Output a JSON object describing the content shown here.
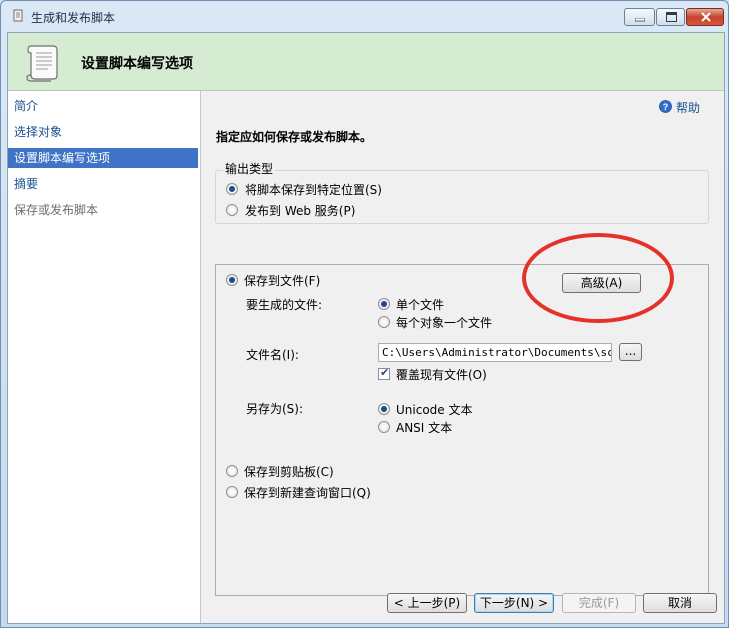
{
  "window": {
    "title": "生成和发布脚本",
    "minimize_icon": "minimize-icon",
    "maximize_icon": "maximize-icon",
    "close_icon": "close-icon"
  },
  "header": {
    "title": "设置脚本编写选项",
    "icon": "script-scroll-icon"
  },
  "nav": {
    "items": [
      {
        "label": "简介"
      },
      {
        "label": "选择对象"
      },
      {
        "label": "设置脚本编写选项"
      },
      {
        "label": "摘要"
      },
      {
        "label": "保存或发布脚本"
      }
    ]
  },
  "help": {
    "label": "帮助",
    "icon": "help-icon"
  },
  "instruction": "指定应如何保存或发布脚本。",
  "output_type": {
    "legend": "输出类型",
    "option_save": "将脚本保存到特定位置(S)",
    "option_publish": "发布到 Web 服务(P)"
  },
  "save_file": {
    "label": "保存到文件(F)",
    "advanced_button": "高级(A)",
    "files_to_generate_label": "要生成的文件:",
    "single_file": "单个文件",
    "file_per_object": "每个对象一个文件",
    "file_name_label": "文件名(I):",
    "file_name_value": "C:\\Users\\Administrator\\Documents\\script.sql",
    "browse_button": "...",
    "overwrite_label": "覆盖现有文件(O)",
    "save_as_label": "另存为(S):",
    "unicode_text": "Unicode 文本",
    "ansi_text": "ANSI 文本"
  },
  "save_clipboard": "保存到剪贴板(C)",
  "save_query_window": "保存到新建查询窗口(Q)",
  "footer": {
    "previous": "< 上一步(P)",
    "next": "下一步(N) >",
    "finish": "完成(F)",
    "cancel": "取消"
  },
  "colors": {
    "header_bg": "#d5ecd2",
    "nav_selected": "#3e73c5",
    "annotation": "#e4322b"
  }
}
